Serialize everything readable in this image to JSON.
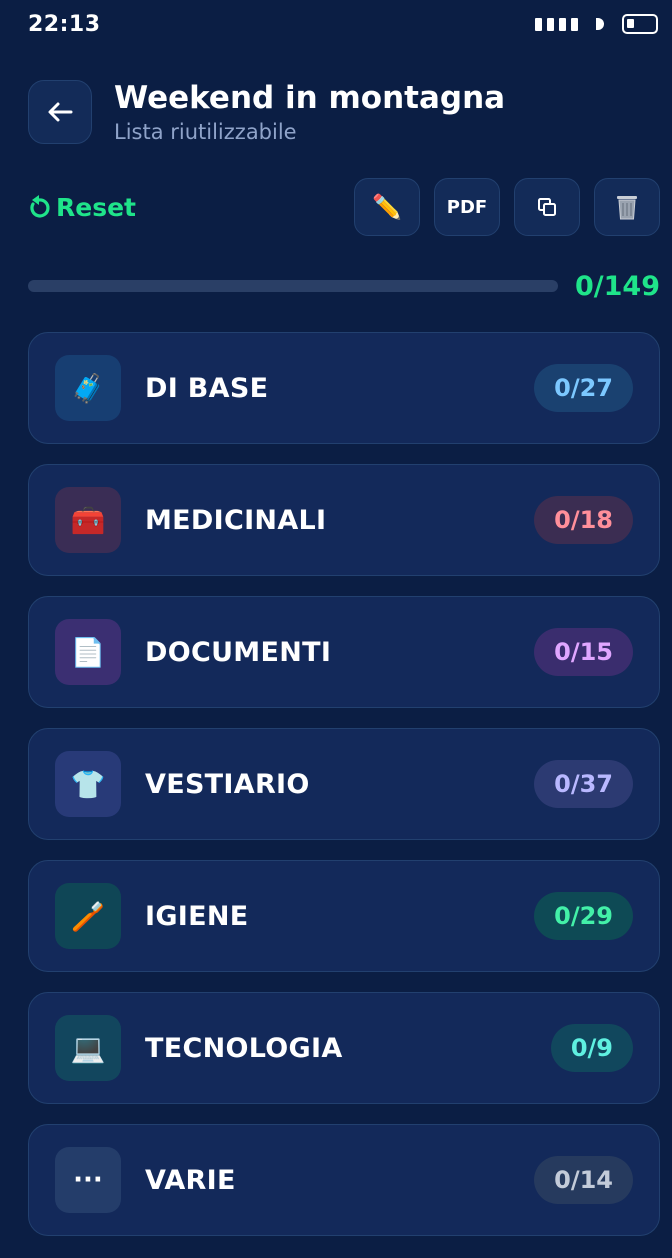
{
  "status": {
    "time": "22:13"
  },
  "header": {
    "title": "Weekend in montagna",
    "subtitle": "Lista riutilizzabile"
  },
  "actions": {
    "reset_label": "Reset",
    "pdf_label": "PDF"
  },
  "progress": {
    "count": "0/149",
    "fraction": 0
  },
  "categories": [
    {
      "name": "DI BASE",
      "count": "0/27",
      "icon": "🧳",
      "icon_bg": "#173e72",
      "badge_bg": "#1a4170",
      "badge_color": "#7cc8ff"
    },
    {
      "name": "MEDICINALI",
      "count": "0/18",
      "icon": "🧰",
      "icon_bg": "#3a2d55",
      "badge_bg": "#3b2d52",
      "badge_color": "#ff8f9a"
    },
    {
      "name": "DOCUMENTI",
      "count": "0/15",
      "icon": "📄",
      "icon_bg": "#3b2f72",
      "badge_bg": "#3a2d6e",
      "badge_color": "#e0a6ff"
    },
    {
      "name": "VESTIARIO",
      "count": "0/37",
      "icon": "👕",
      "icon_bg": "#283a78",
      "badge_bg": "#2c3a72",
      "badge_color": "#b9b8ff"
    },
    {
      "name": "IGIENE",
      "count": "0/29",
      "icon": "🪥",
      "icon_bg": "#0f4656",
      "badge_bg": "#0e4a55",
      "badge_color": "#43f0a8"
    },
    {
      "name": "TECNOLOGIA",
      "count": "0/9",
      "icon": "💻",
      "icon_bg": "#12465e",
      "badge_bg": "#11475d",
      "badge_color": "#5ff0e0"
    },
    {
      "name": "VARIE",
      "count": "0/14",
      "icon": "···",
      "icon_bg": "#243d6a",
      "badge_bg": "#263a5e",
      "badge_color": "#c3cbd9"
    }
  ]
}
